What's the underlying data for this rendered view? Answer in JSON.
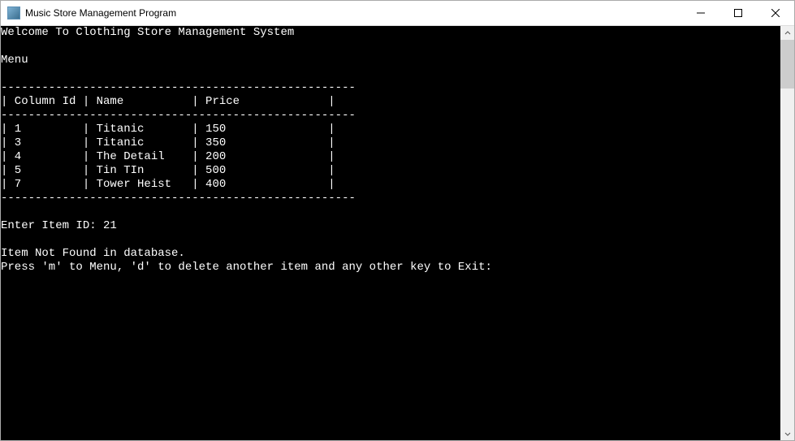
{
  "window": {
    "title": "Music Store Management Program"
  },
  "console": {
    "welcome": "Welcome To Clothing Store Management System",
    "menu_label": "Menu",
    "dashes": "----------------------------------------------------",
    "headers": {
      "col1": "Column Id",
      "col2": "Name",
      "col3": "Price"
    },
    "items": [
      {
        "id": "1",
        "name": "Titanic",
        "price": "150"
      },
      {
        "id": "3",
        "name": "Titanic",
        "price": "350"
      },
      {
        "id": "4",
        "name": "The Detail",
        "price": "200"
      },
      {
        "id": "5",
        "name": "Tin TIn",
        "price": "500"
      },
      {
        "id": "7",
        "name": "Tower Heist",
        "price": "400"
      }
    ],
    "prompt_label": "Enter Item ID: ",
    "prompt_value": "21",
    "not_found": "Item Not Found in database.",
    "press_msg": "Press 'm' to Menu, 'd' to delete another item and any other key to Exit:"
  }
}
